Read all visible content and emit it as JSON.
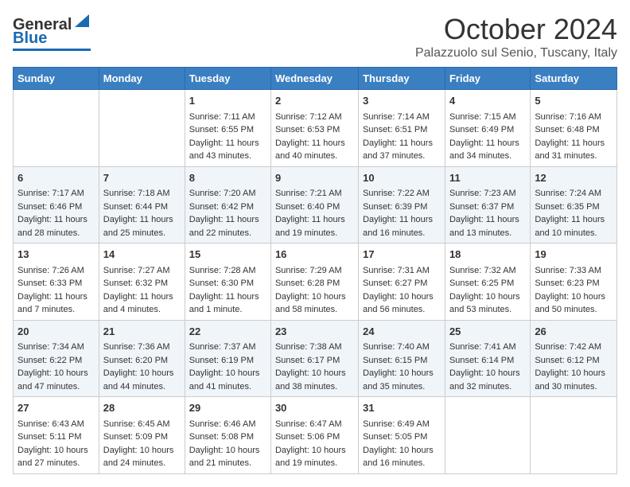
{
  "header": {
    "logo_general": "General",
    "logo_blue": "Blue",
    "month": "October 2024",
    "location": "Palazzuolo sul Senio, Tuscany, Italy"
  },
  "days_of_week": [
    "Sunday",
    "Monday",
    "Tuesday",
    "Wednesday",
    "Thursday",
    "Friday",
    "Saturday"
  ],
  "weeks": [
    [
      {
        "day": "",
        "sunrise": "",
        "sunset": "",
        "daylight": ""
      },
      {
        "day": "",
        "sunrise": "",
        "sunset": "",
        "daylight": ""
      },
      {
        "day": "1",
        "sunrise": "Sunrise: 7:11 AM",
        "sunset": "Sunset: 6:55 PM",
        "daylight": "Daylight: 11 hours and 43 minutes."
      },
      {
        "day": "2",
        "sunrise": "Sunrise: 7:12 AM",
        "sunset": "Sunset: 6:53 PM",
        "daylight": "Daylight: 11 hours and 40 minutes."
      },
      {
        "day": "3",
        "sunrise": "Sunrise: 7:14 AM",
        "sunset": "Sunset: 6:51 PM",
        "daylight": "Daylight: 11 hours and 37 minutes."
      },
      {
        "day": "4",
        "sunrise": "Sunrise: 7:15 AM",
        "sunset": "Sunset: 6:49 PM",
        "daylight": "Daylight: 11 hours and 34 minutes."
      },
      {
        "day": "5",
        "sunrise": "Sunrise: 7:16 AM",
        "sunset": "Sunset: 6:48 PM",
        "daylight": "Daylight: 11 hours and 31 minutes."
      }
    ],
    [
      {
        "day": "6",
        "sunrise": "Sunrise: 7:17 AM",
        "sunset": "Sunset: 6:46 PM",
        "daylight": "Daylight: 11 hours and 28 minutes."
      },
      {
        "day": "7",
        "sunrise": "Sunrise: 7:18 AM",
        "sunset": "Sunset: 6:44 PM",
        "daylight": "Daylight: 11 hours and 25 minutes."
      },
      {
        "day": "8",
        "sunrise": "Sunrise: 7:20 AM",
        "sunset": "Sunset: 6:42 PM",
        "daylight": "Daylight: 11 hours and 22 minutes."
      },
      {
        "day": "9",
        "sunrise": "Sunrise: 7:21 AM",
        "sunset": "Sunset: 6:40 PM",
        "daylight": "Daylight: 11 hours and 19 minutes."
      },
      {
        "day": "10",
        "sunrise": "Sunrise: 7:22 AM",
        "sunset": "Sunset: 6:39 PM",
        "daylight": "Daylight: 11 hours and 16 minutes."
      },
      {
        "day": "11",
        "sunrise": "Sunrise: 7:23 AM",
        "sunset": "Sunset: 6:37 PM",
        "daylight": "Daylight: 11 hours and 13 minutes."
      },
      {
        "day": "12",
        "sunrise": "Sunrise: 7:24 AM",
        "sunset": "Sunset: 6:35 PM",
        "daylight": "Daylight: 11 hours and 10 minutes."
      }
    ],
    [
      {
        "day": "13",
        "sunrise": "Sunrise: 7:26 AM",
        "sunset": "Sunset: 6:33 PM",
        "daylight": "Daylight: 11 hours and 7 minutes."
      },
      {
        "day": "14",
        "sunrise": "Sunrise: 7:27 AM",
        "sunset": "Sunset: 6:32 PM",
        "daylight": "Daylight: 11 hours and 4 minutes."
      },
      {
        "day": "15",
        "sunrise": "Sunrise: 7:28 AM",
        "sunset": "Sunset: 6:30 PM",
        "daylight": "Daylight: 11 hours and 1 minute."
      },
      {
        "day": "16",
        "sunrise": "Sunrise: 7:29 AM",
        "sunset": "Sunset: 6:28 PM",
        "daylight": "Daylight: 10 hours and 58 minutes."
      },
      {
        "day": "17",
        "sunrise": "Sunrise: 7:31 AM",
        "sunset": "Sunset: 6:27 PM",
        "daylight": "Daylight: 10 hours and 56 minutes."
      },
      {
        "day": "18",
        "sunrise": "Sunrise: 7:32 AM",
        "sunset": "Sunset: 6:25 PM",
        "daylight": "Daylight: 10 hours and 53 minutes."
      },
      {
        "day": "19",
        "sunrise": "Sunrise: 7:33 AM",
        "sunset": "Sunset: 6:23 PM",
        "daylight": "Daylight: 10 hours and 50 minutes."
      }
    ],
    [
      {
        "day": "20",
        "sunrise": "Sunrise: 7:34 AM",
        "sunset": "Sunset: 6:22 PM",
        "daylight": "Daylight: 10 hours and 47 minutes."
      },
      {
        "day": "21",
        "sunrise": "Sunrise: 7:36 AM",
        "sunset": "Sunset: 6:20 PM",
        "daylight": "Daylight: 10 hours and 44 minutes."
      },
      {
        "day": "22",
        "sunrise": "Sunrise: 7:37 AM",
        "sunset": "Sunset: 6:19 PM",
        "daylight": "Daylight: 10 hours and 41 minutes."
      },
      {
        "day": "23",
        "sunrise": "Sunrise: 7:38 AM",
        "sunset": "Sunset: 6:17 PM",
        "daylight": "Daylight: 10 hours and 38 minutes."
      },
      {
        "day": "24",
        "sunrise": "Sunrise: 7:40 AM",
        "sunset": "Sunset: 6:15 PM",
        "daylight": "Daylight: 10 hours and 35 minutes."
      },
      {
        "day": "25",
        "sunrise": "Sunrise: 7:41 AM",
        "sunset": "Sunset: 6:14 PM",
        "daylight": "Daylight: 10 hours and 32 minutes."
      },
      {
        "day": "26",
        "sunrise": "Sunrise: 7:42 AM",
        "sunset": "Sunset: 6:12 PM",
        "daylight": "Daylight: 10 hours and 30 minutes."
      }
    ],
    [
      {
        "day": "27",
        "sunrise": "Sunrise: 6:43 AM",
        "sunset": "Sunset: 5:11 PM",
        "daylight": "Daylight: 10 hours and 27 minutes."
      },
      {
        "day": "28",
        "sunrise": "Sunrise: 6:45 AM",
        "sunset": "Sunset: 5:09 PM",
        "daylight": "Daylight: 10 hours and 24 minutes."
      },
      {
        "day": "29",
        "sunrise": "Sunrise: 6:46 AM",
        "sunset": "Sunset: 5:08 PM",
        "daylight": "Daylight: 10 hours and 21 minutes."
      },
      {
        "day": "30",
        "sunrise": "Sunrise: 6:47 AM",
        "sunset": "Sunset: 5:06 PM",
        "daylight": "Daylight: 10 hours and 19 minutes."
      },
      {
        "day": "31",
        "sunrise": "Sunrise: 6:49 AM",
        "sunset": "Sunset: 5:05 PM",
        "daylight": "Daylight: 10 hours and 16 minutes."
      },
      {
        "day": "",
        "sunrise": "",
        "sunset": "",
        "daylight": ""
      },
      {
        "day": "",
        "sunrise": "",
        "sunset": "",
        "daylight": ""
      }
    ]
  ]
}
